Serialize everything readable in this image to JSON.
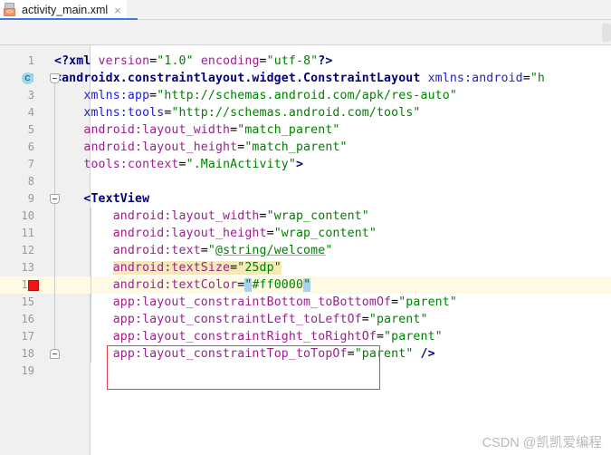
{
  "window": {
    "tab": {
      "filename": "activity_main.xml",
      "icon": "xml-file-icon",
      "badge_text": "<>",
      "close_glyph": "×",
      "active": true,
      "accent_color": "#3b7dd8"
    }
  },
  "editor": {
    "language": "XML",
    "first_line": 1,
    "last_line": 19,
    "caret_line": 14,
    "gutter_markers": {
      "line_2_icon": "class-marker-icon",
      "line_2_icon_letter": "C",
      "line_14_icon": "bookmark-square-icon",
      "line_14_color": "#f01414"
    },
    "fold_markers": [
      2,
      9,
      18
    ],
    "colors": {
      "tag": "#000080",
      "attribute": "#9b1f8f",
      "namespace": "#2020d0",
      "value": "#008000",
      "selection": "#a6d2f5",
      "search_highlight": "#f5e9b9",
      "caret_row": "#fffae3",
      "gutter_bg": "#f0f0f0"
    },
    "lines": [
      {
        "n": "1",
        "indent": 0,
        "tokens": [
          {
            "t": "<?xml ",
            "c": "t-proc"
          },
          {
            "t": "version",
            "c": "t-attr"
          },
          {
            "t": "=",
            "c": "t-punct"
          },
          {
            "t": "\"1.0\"",
            "c": "t-val"
          },
          {
            "t": " ",
            "c": "t-punct"
          },
          {
            "t": "encoding",
            "c": "t-attr"
          },
          {
            "t": "=",
            "c": "t-punct"
          },
          {
            "t": "\"utf-8\"",
            "c": "t-val"
          },
          {
            "t": "?>",
            "c": "t-proc"
          }
        ]
      },
      {
        "n": "2",
        "indent": 0,
        "tokens": [
          {
            "t": "<androidx.constraintlayout.widget.ConstraintLayout ",
            "c": "t-tag"
          },
          {
            "t": "xmlns:android",
            "c": "t-ns"
          },
          {
            "t": "=",
            "c": "t-punct"
          },
          {
            "t": "\"h",
            "c": "t-val"
          }
        ]
      },
      {
        "n": "3",
        "indent": 0,
        "tokens": [
          {
            "t": "    ",
            "c": "t-punct"
          },
          {
            "t": "xmlns:app",
            "c": "t-ns"
          },
          {
            "t": "=",
            "c": "t-punct"
          },
          {
            "t": "\"http://schemas.android.com/apk/res-auto\"",
            "c": "t-val"
          }
        ]
      },
      {
        "n": "4",
        "indent": 0,
        "tokens": [
          {
            "t": "    ",
            "c": "t-punct"
          },
          {
            "t": "xmlns:tools",
            "c": "t-ns"
          },
          {
            "t": "=",
            "c": "t-punct"
          },
          {
            "t": "\"http://schemas.android.com/tools\"",
            "c": "t-val"
          }
        ]
      },
      {
        "n": "5",
        "indent": 0,
        "tokens": [
          {
            "t": "    ",
            "c": "t-punct"
          },
          {
            "t": "android:layout_width",
            "c": "t-attr"
          },
          {
            "t": "=",
            "c": "t-punct"
          },
          {
            "t": "\"match_parent\"",
            "c": "t-val"
          }
        ]
      },
      {
        "n": "6",
        "indent": 0,
        "tokens": [
          {
            "t": "    ",
            "c": "t-punct"
          },
          {
            "t": "android:layout_height",
            "c": "t-attr"
          },
          {
            "t": "=",
            "c": "t-punct"
          },
          {
            "t": "\"match_parent\"",
            "c": "t-val"
          }
        ]
      },
      {
        "n": "7",
        "indent": 0,
        "tokens": [
          {
            "t": "    ",
            "c": "t-punct"
          },
          {
            "t": "tools:context",
            "c": "t-attr"
          },
          {
            "t": "=",
            "c": "t-punct"
          },
          {
            "t": "\".MainActivity\"",
            "c": "t-val"
          },
          {
            "t": ">",
            "c": "t-tag"
          }
        ]
      },
      {
        "n": "8",
        "indent": 0,
        "tokens": []
      },
      {
        "n": "9",
        "indent": 0,
        "tokens": [
          {
            "t": "    ",
            "c": "t-punct"
          },
          {
            "t": "<TextView",
            "c": "t-tag"
          }
        ]
      },
      {
        "n": "10",
        "indent": 0,
        "tokens": [
          {
            "t": "        ",
            "c": "t-punct"
          },
          {
            "t": "android:layout_width",
            "c": "t-attr"
          },
          {
            "t": "=",
            "c": "t-punct"
          },
          {
            "t": "\"wrap_content\"",
            "c": "t-val"
          }
        ]
      },
      {
        "n": "11",
        "indent": 0,
        "tokens": [
          {
            "t": "        ",
            "c": "t-punct"
          },
          {
            "t": "android:layout_height",
            "c": "t-attr"
          },
          {
            "t": "=",
            "c": "t-punct"
          },
          {
            "t": "\"wrap_content\"",
            "c": "t-val"
          }
        ]
      },
      {
        "n": "12",
        "indent": 0,
        "tokens": [
          {
            "t": "        ",
            "c": "t-punct"
          },
          {
            "t": "android:text",
            "c": "t-attr"
          },
          {
            "t": "=",
            "c": "t-punct"
          },
          {
            "t": "\"",
            "c": "t-val"
          },
          {
            "t": "@string/welcome",
            "c": "t-ref"
          },
          {
            "t": "\"",
            "c": "t-val"
          }
        ]
      },
      {
        "n": "13",
        "indent": 0,
        "tokens": [
          {
            "t": "        ",
            "c": "t-punct"
          },
          {
            "t": "android:textSize",
            "c": "t-attr searchhl"
          },
          {
            "t": "=",
            "c": "t-punct searchhl"
          },
          {
            "t": "\"25dp\"",
            "c": "t-val searchhl"
          }
        ]
      },
      {
        "n": "14",
        "indent": 0,
        "tokens": [
          {
            "t": "        ",
            "c": "t-punct"
          },
          {
            "t": "android:textColor",
            "c": "t-attr"
          },
          {
            "t": "=",
            "c": "t-punct"
          },
          {
            "t": "\"",
            "c": "t-val sel"
          },
          {
            "t": "#ff0000",
            "c": "t-val"
          },
          {
            "t": "\"",
            "c": "t-val sel"
          }
        ]
      },
      {
        "n": "15",
        "indent": 0,
        "tokens": [
          {
            "t": "        ",
            "c": "t-punct"
          },
          {
            "t": "app:layout_constraintBottom_toBottomOf",
            "c": "t-attr"
          },
          {
            "t": "=",
            "c": "t-punct"
          },
          {
            "t": "\"parent\"",
            "c": "t-val"
          }
        ]
      },
      {
        "n": "16",
        "indent": 0,
        "tokens": [
          {
            "t": "        ",
            "c": "t-punct"
          },
          {
            "t": "app:layout_constraintLeft_toLeftOf",
            "c": "t-attr"
          },
          {
            "t": "=",
            "c": "t-punct"
          },
          {
            "t": "\"parent\"",
            "c": "t-val"
          }
        ]
      },
      {
        "n": "17",
        "indent": 0,
        "tokens": [
          {
            "t": "        ",
            "c": "t-punct"
          },
          {
            "t": "app:layout_constraintRight_toRightOf",
            "c": "t-attr"
          },
          {
            "t": "=",
            "c": "t-punct"
          },
          {
            "t": "\"parent\"",
            "c": "t-val"
          }
        ]
      },
      {
        "n": "18",
        "indent": 0,
        "tokens": [
          {
            "t": "        ",
            "c": "t-punct"
          },
          {
            "t": "app:layout_constraintTop_toTopOf",
            "c": "t-attr"
          },
          {
            "t": "=",
            "c": "t-punct"
          },
          {
            "t": "\"parent\"",
            "c": "t-val"
          },
          {
            "t": " />",
            "c": "t-tag"
          }
        ]
      },
      {
        "n": "19",
        "indent": 0,
        "tokens": []
      }
    ]
  },
  "annotation": {
    "type": "red-rectangle-highlight",
    "color": "#e8404a",
    "covers_lines": "13-14"
  },
  "watermark": {
    "text": "CSDN @凯凯爱编程"
  }
}
